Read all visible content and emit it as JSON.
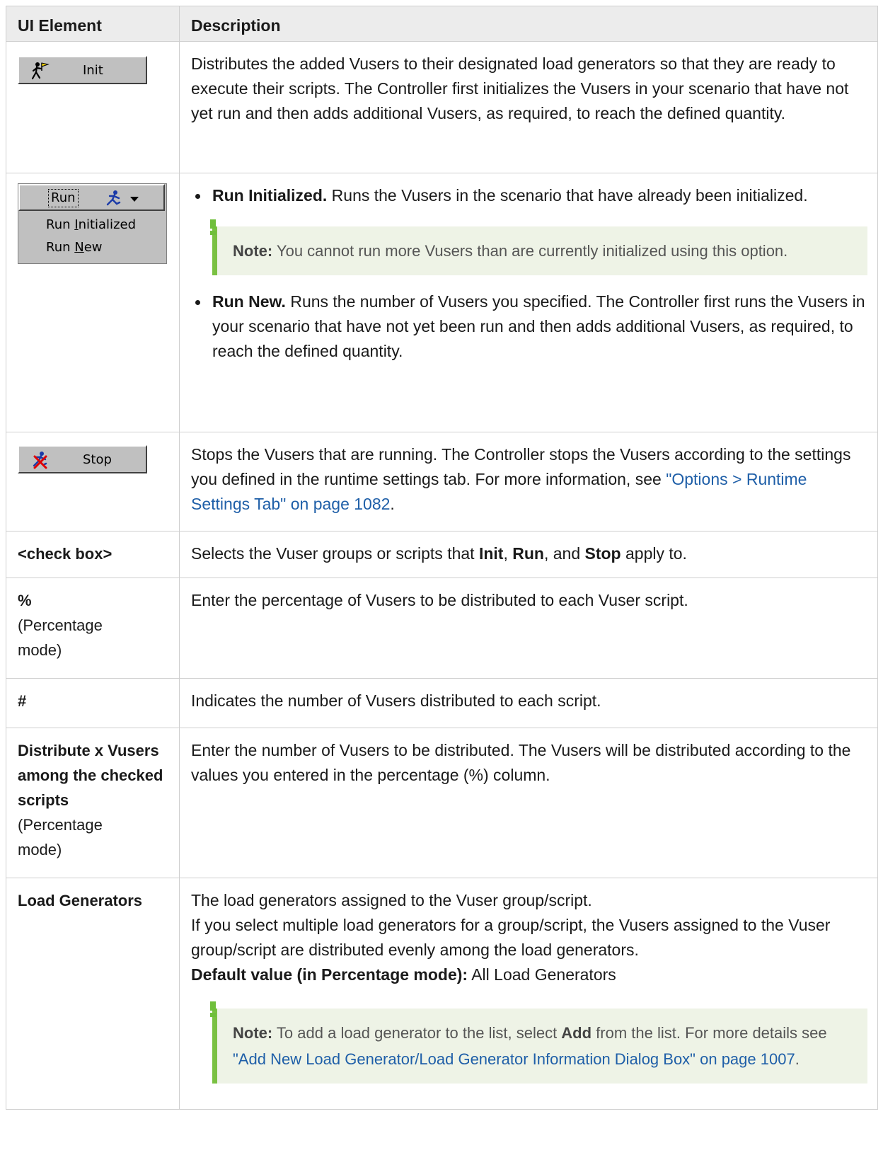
{
  "table": {
    "headers": [
      "UI Element",
      "Description"
    ],
    "init_row": {
      "button_label": "Init",
      "button_icon": "runner-flag-icon",
      "description": "Distributes the added Vusers to their designated load generators so that they are ready to execute their scripts. The Controller first initializes the Vusers in your scenario that have not yet run and then adds additional Vusers, as required, to reach the defined quantity."
    },
    "run_row": {
      "button_label": "Run",
      "button_icon": "runner-icon",
      "menu_item_1_prefix": "Run ",
      "menu_item_1_accel": "I",
      "menu_item_1_rest": "nitialized",
      "menu_item_2_prefix": "Run ",
      "menu_item_2_accel": "N",
      "menu_item_2_rest": "ew",
      "bullet_1_bold": "Run Initialized.",
      "bullet_1_text": " Runs the Vusers in the scenario that have already been initialized.",
      "note_label": "Note:",
      "note_text": " You cannot run more Vusers than are currently initialized using this option.",
      "bullet_2_bold": "Run New.",
      "bullet_2_text": " Runs the number of Vusers you specified. The Controller first runs the Vusers in your scenario that have not yet been run and then adds additional Vusers, as required, to reach the defined quantity."
    },
    "stop_row": {
      "button_label": "Stop",
      "button_icon": "runner-stop-icon",
      "description_text": "Stops the Vusers that are running. The Controller stops the Vusers according to the settings you defined in the runtime settings tab. For more information, see ",
      "link_text": "\"Options > Runtime Settings Tab\" on page 1082",
      "description_end": "."
    },
    "checkbox_row": {
      "element": "<check box>",
      "t1": "Selects the Vuser groups or scripts that ",
      "b1": "Init",
      "t2": ", ",
      "b2": "Run",
      "t3": ", and ",
      "b3": "Stop",
      "t4": " apply to."
    },
    "percent_row": {
      "element_bold": "%",
      "element_sub": "(Percentage mode)",
      "description": "Enter the percentage of Vusers to be distributed to each Vuser script."
    },
    "number_row": {
      "element_bold": "#",
      "description": "Indicates the number of Vusers distributed to each script."
    },
    "distribute_row": {
      "element_bold": "Distribute x Vusers among the checked scripts",
      "element_sub": "(Percentage mode)",
      "description": "Enter the number of Vusers to be distributed. The Vusers will be distributed according to the values you entered in the percentage (%) column."
    },
    "loadgen_row": {
      "element_bold": "Load Generators",
      "line1": "The load generators assigned to the Vuser group/script.",
      "line2": "If you select multiple load generators for a group/script, the Vusers assigned to the Vuser group/script are distributed evenly among the load generators.",
      "default_label": "Default value (in Percentage mode):",
      "default_value": " All Load Generators",
      "note_label": "Note:",
      "note_t1": " To add a load generator to the list, select ",
      "note_b1": "Add",
      "note_t2": " from the list. For more details see ",
      "note_link": "\"Add New Load Generator/Load Generator Information Dialog Box\" on page 1007",
      "note_end": "."
    }
  },
  "colors": {
    "header_bg": "#ececec",
    "note_bg": "#eef3e6",
    "note_border": "#7ac142",
    "link": "#1f5fa8"
  }
}
